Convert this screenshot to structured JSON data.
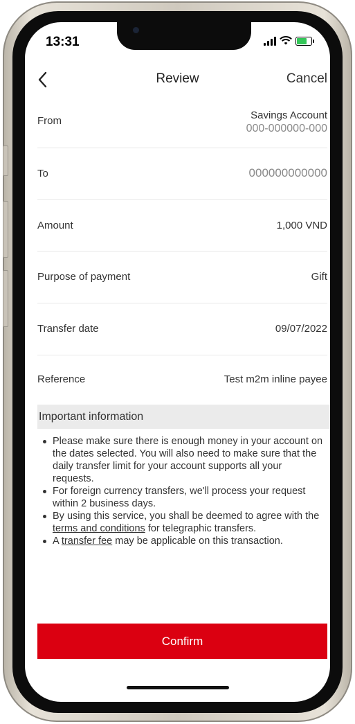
{
  "status_bar": {
    "time": "13:31"
  },
  "nav": {
    "title": "Review",
    "cancel_label": "Cancel"
  },
  "details": {
    "from_label": "From",
    "from_account_name": "Savings Account",
    "from_account_number": "000-000000-000",
    "to_label": "To",
    "to_account_number": "000000000000",
    "amount_label": "Amount",
    "amount_value": "1,000 VND",
    "purpose_label": "Purpose of payment",
    "purpose_value": "Gift",
    "date_label": "Transfer date",
    "date_value": "09/07/2022",
    "reference_label": "Reference",
    "reference_value": "Test m2m inline payee"
  },
  "important": {
    "header": "Important information",
    "item1": "Please make sure there is enough money in your account on the dates selected. You will also need to make sure that the daily transfer limit for your account supports all your requests.",
    "item2": "For foreign currency transfers, we'll process your request within 2 business days.",
    "item3_prefix": "By using this service, you shall be deemed to agree with the ",
    "item3_link": "terms and conditions",
    "item3_suffix": " for telegraphic transfers.",
    "item4_prefix": "A ",
    "item4_link": "transfer fee",
    "item4_suffix": " may be applicable on this transaction."
  },
  "actions": {
    "confirm_label": "Confirm"
  },
  "icons": {
    "back": "chevron-left-icon",
    "signal": "signal-icon",
    "wifi": "wifi-icon",
    "battery": "battery-charging-icon"
  },
  "colors": {
    "primary": "#db0011",
    "section_bg": "#ebebeb"
  }
}
